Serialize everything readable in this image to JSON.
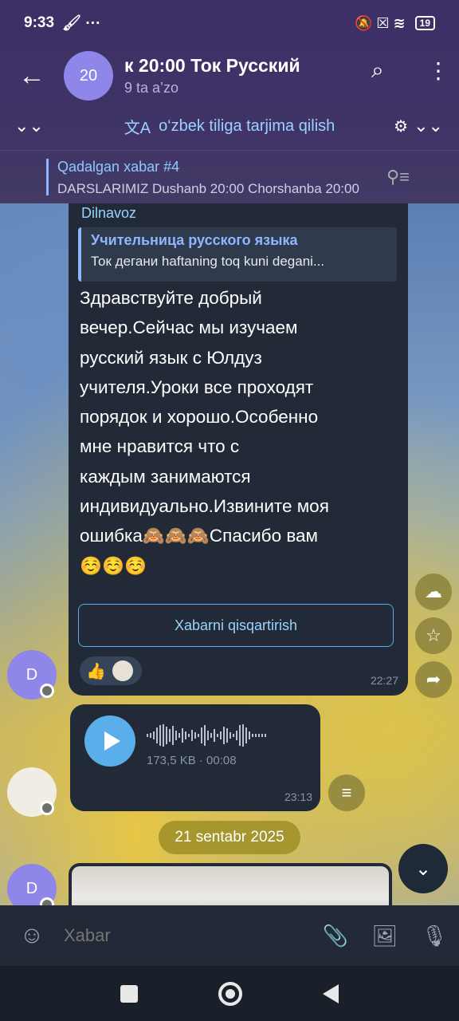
{
  "status": {
    "time": "9:33",
    "extra_icons": "🖌 ···",
    "right_icons": "🔕 ☒ ≋",
    "battery": "19"
  },
  "header": {
    "avatar_text": "20",
    "title": "к  20:00 Ток Русский",
    "subtitle": "9 ta a’zo",
    "back_icon": "←",
    "search_icon": "⌕",
    "menu_icon": "⋮"
  },
  "translate": {
    "label": "o‘zbek tiliga tarjima qilish",
    "left_chevron": "⌄⌄",
    "right_chevron": "⌄⌄",
    "settings_icon": "⚙"
  },
  "pinned": {
    "title": "Qadalgan xabar #4",
    "text": "DARSLARIMIZ  Dushanb 20:00 Chorshanba 20:00"
  },
  "messages": {
    "main": {
      "sender": "Dilnavoz",
      "reply_title": "Учительница русского языка",
      "reply_text": "Ток дегани haftaning toq kuni degani...",
      "text": "Здравствуйте добрый\nвечер.Сейчас мы изучаем\nрусский язык с Юлдуз\nучителя.Уроки все проходят\nпорядок и хорошо.Особенно\nмне нравится что с\nкаждым занимаются\nиндивидуально.Извините моя\nошибка🙈🙈🙈Спасибо вам\n☺️☺️☺️",
      "shorten_button": "Xabarni qisqartirish",
      "reaction_emoji": "👍",
      "time": "22:27",
      "avatar_text": "D"
    },
    "voice": {
      "size_duration": "173,5 KB · 00:08",
      "time": "23:13"
    },
    "date_separator": "21 sentabr 2025",
    "photo_avatar_text": "D"
  },
  "side_buttons": {
    "cloud_icon": "☁",
    "star_icon": "☆",
    "share_icon": "➦",
    "list_icon": "≡",
    "scroll_down_icon": "⌄"
  },
  "input": {
    "placeholder": "Xabar",
    "emoji_icon": "☺",
    "attach_icon": "📎",
    "sticker_icon": "🖼",
    "mic_icon": "🎙"
  }
}
